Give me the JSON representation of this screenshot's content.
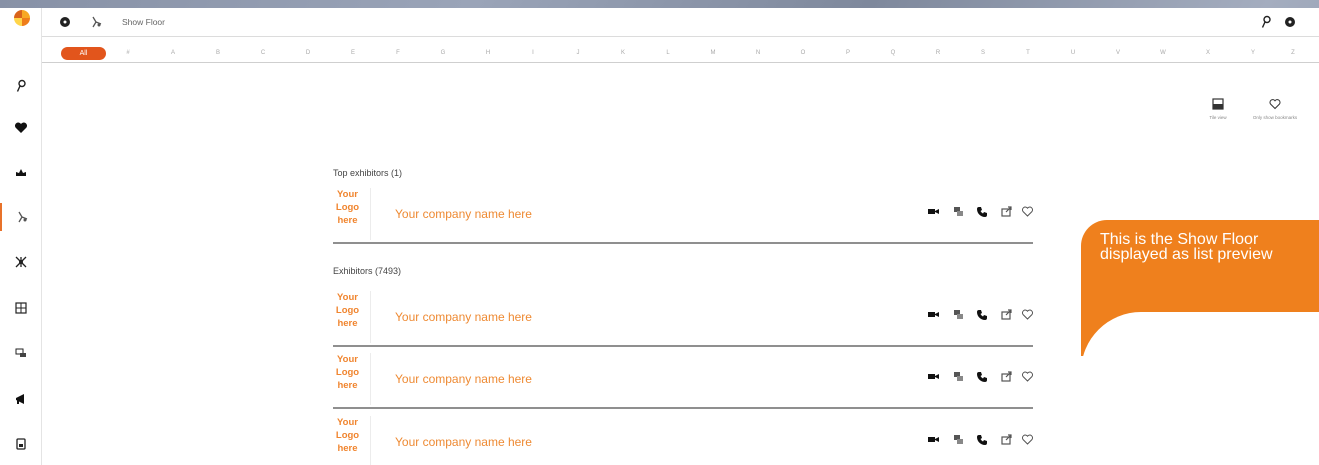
{
  "header": {
    "breadcrumb": "Show Floor"
  },
  "alphabet": {
    "all_label": "All",
    "letters": [
      "#",
      "A",
      "B",
      "C",
      "D",
      "E",
      "F",
      "G",
      "H",
      "I",
      "J",
      "K",
      "L",
      "M",
      "N",
      "O",
      "P",
      "Q",
      "R",
      "S",
      "T",
      "U",
      "V",
      "W",
      "X",
      "Y",
      "Z"
    ]
  },
  "view_options": {
    "tile_view": "Tile view",
    "only_bookmarks": "Only show bookmarks"
  },
  "sections": {
    "top_exhibitors": "Top exhibitors (1)",
    "exhibitors": "Exhibitors (7493)"
  },
  "exhibitor_row": {
    "logo_line1": "Your",
    "logo_line2": "Logo",
    "logo_line3": "here",
    "company": "Your company name here"
  },
  "tooltip": {
    "line1": "This is the Show Floor",
    "line2": "displayed as list preview"
  },
  "colors": {
    "accent": "#e2551c",
    "brand_orange": "#ef801d",
    "company_text": "#ee8a33"
  },
  "icons": {
    "sidebar": [
      "pin-icon",
      "heart-icon",
      "crown-icon",
      "show-floor-icon",
      "network-icon",
      "sessions-icon",
      "meetings-icon",
      "megaphone-icon",
      "badge-icon"
    ],
    "row_actions": [
      "video-icon",
      "chat-icon",
      "phone-icon",
      "share-icon",
      "bookmark-heart-icon"
    ]
  }
}
